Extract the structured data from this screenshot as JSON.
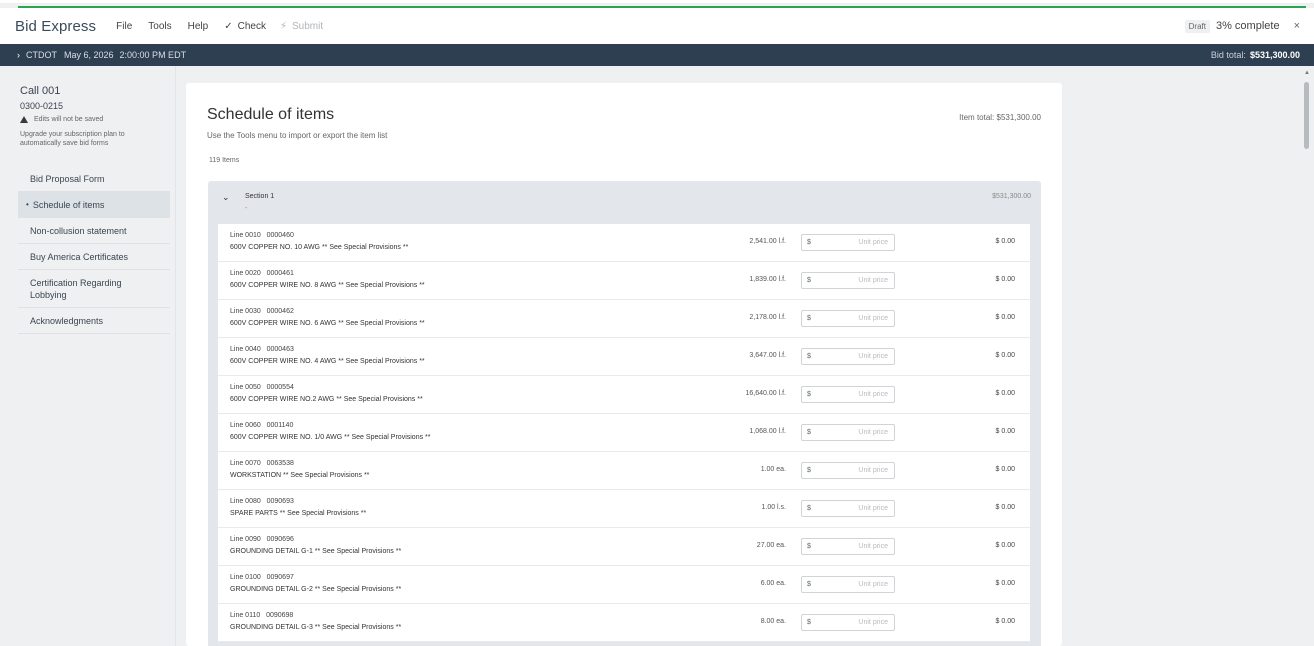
{
  "menubar": {
    "brand": "Bid Express",
    "menus": [
      "File",
      "Tools",
      "Help"
    ],
    "check_label": "Check",
    "submit_label": "Submit",
    "draft_label": "Draft",
    "complete_label": "3% complete",
    "close_glyph": "×"
  },
  "infobar": {
    "agency": "CTDOT",
    "date": "May 6, 2026",
    "time": "2:00:00 PM EDT",
    "bid_total_label": "Bid total:",
    "bid_total_value": "$531,300.00"
  },
  "sidebar": {
    "call_title": "Call 001",
    "call_id": "0300-0215",
    "warning": "Edits will not be saved",
    "upgrade_text": "Upgrade your subscription plan to automatically save bid forms",
    "items": [
      {
        "label": "Bid Proposal Form",
        "active": false
      },
      {
        "label": "Schedule of items",
        "active": true
      },
      {
        "label": "Non-collusion statement",
        "active": false
      },
      {
        "label": "Buy America Certificates",
        "active": false
      },
      {
        "label": "Certification Regarding Lobbying",
        "active": false
      },
      {
        "label": "Acknowledgments",
        "active": false
      }
    ]
  },
  "main": {
    "title": "Schedule of items",
    "subtitle": "Use the Tools menu to import or export the item list",
    "item_total": "Item total: $531,300.00",
    "item_count": "119 Items",
    "section": {
      "name": "Section 1",
      "dash": "-",
      "total": "$531,300.00"
    },
    "currency_symbol": "$",
    "price_placeholder": "Unit price",
    "rows": [
      {
        "line": "Line 0010",
        "code": "0000460",
        "desc": "600V COPPER NO. 10 AWG ** See Special Provisions **",
        "qty": "2,541.00 l.f.",
        "ext": "$ 0.00"
      },
      {
        "line": "Line 0020",
        "code": "0000461",
        "desc": "600V COPPER WIRE NO. 8 AWG ** See Special Provisions **",
        "qty": "1,839.00 l.f.",
        "ext": "$ 0.00"
      },
      {
        "line": "Line 0030",
        "code": "0000462",
        "desc": "600V COPPER WIRE NO. 6 AWG ** See Special Provisions **",
        "qty": "2,178.00 l.f.",
        "ext": "$ 0.00"
      },
      {
        "line": "Line 0040",
        "code": "0000463",
        "desc": "600V COPPER WIRE NO. 4 AWG ** See Special Provisions **",
        "qty": "3,647.00 l.f.",
        "ext": "$ 0.00"
      },
      {
        "line": "Line 0050",
        "code": "0000554",
        "desc": "600V COPPER WIRE NO.2 AWG ** See Special Provisions **",
        "qty": "16,640.00 l.f.",
        "ext": "$ 0.00"
      },
      {
        "line": "Line 0060",
        "code": "0001140",
        "desc": "600V COPPER WIRE NO. 1/0 AWG ** See Special Provisions **",
        "qty": "1,068.00 l.f.",
        "ext": "$ 0.00"
      },
      {
        "line": "Line 0070",
        "code": "0063538",
        "desc": "WORKSTATION ** See Special Provisions **",
        "qty": "1.00 ea.",
        "ext": "$ 0.00"
      },
      {
        "line": "Line 0080",
        "code": "0090693",
        "desc": "SPARE PARTS ** See Special Provisions **",
        "qty": "1.00 l.s.",
        "ext": "$ 0.00"
      },
      {
        "line": "Line 0090",
        "code": "0090696",
        "desc": "GROUNDING DETAIL G-1 ** See Special Provisions **",
        "qty": "27.00 ea.",
        "ext": "$ 0.00"
      },
      {
        "line": "Line 0100",
        "code": "0090697",
        "desc": "GROUNDING DETAIL G-2 ** See Special Provisions **",
        "qty": "6.00 ea.",
        "ext": "$ 0.00"
      },
      {
        "line": "Line 0110",
        "code": "0090698",
        "desc": "GROUNDING DETAIL G-3 ** See Special Provisions **",
        "qty": "8.00 ea.",
        "ext": "$ 0.00"
      }
    ]
  },
  "colors": {
    "accent_green": "#2aa452",
    "darkbar": "#2f3f52"
  }
}
